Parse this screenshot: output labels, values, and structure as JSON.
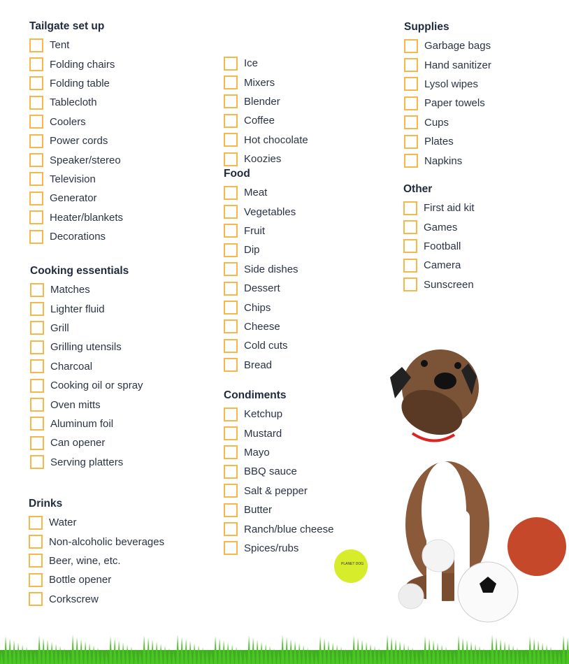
{
  "accent_color": "#f7b84b",
  "sections": [
    {
      "title": "Tailgate set up",
      "items": [
        "Tent",
        "Folding  chairs",
        "Folding table",
        "Tablecloth",
        "Coolers",
        "Power cords",
        "Speaker/stereo",
        "Television",
        "Generator",
        "Heater/blankets",
        "Decorations"
      ]
    },
    {
      "title": "Cooking essentials",
      "items": [
        "Matches",
        "Lighter fluid",
        "Grill",
        "Grilling utensils",
        "Charcoal",
        "Cooking oil or spray",
        "Oven mitts",
        "Aluminum foil",
        "Can opener",
        "Serving platters"
      ]
    },
    {
      "title": "Drinks",
      "items": [
        "Water",
        "Non-alcoholic beverages",
        "Beer, wine, etc.",
        "Bottle opener",
        "Corkscrew"
      ]
    },
    {
      "title": "",
      "items": [
        "Ice",
        "Mixers",
        "Blender",
        "Coffee",
        "Hot chocolate",
        "Koozies"
      ]
    },
    {
      "title": "Food",
      "items": [
        "Meat",
        "Vegetables",
        "Fruit",
        "Dip",
        "Side dishes",
        "Dessert",
        "Chips",
        "Cheese",
        "Cold cuts",
        "Bread"
      ]
    },
    {
      "title": "Condiments",
      "items": [
        "Ketchup",
        "Mustard",
        "Mayo",
        "BBQ sauce",
        "Salt & pepper",
        "Butter",
        "Ranch/blue cheese",
        "Spices/rubs"
      ]
    },
    {
      "title": "Supplies",
      "items": [
        "Garbage bags",
        "Hand sanitizer",
        "Lysol wipes",
        "Paper towels",
        "Cups",
        "Plates",
        "Napkins"
      ]
    },
    {
      "title": "Other",
      "items": [
        "First aid kit",
        "Games",
        "Football",
        "Camera",
        "Sunscreen"
      ]
    }
  ],
  "illustration": {
    "tennis_ball_text": "PLANET DOG"
  }
}
